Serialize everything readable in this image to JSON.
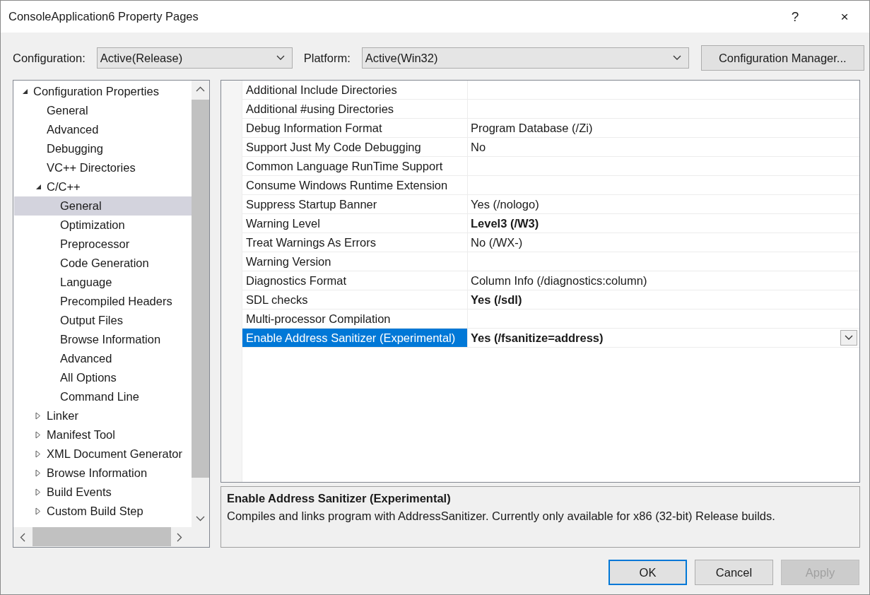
{
  "window": {
    "title": "ConsoleApplication6 Property Pages",
    "help": "?",
    "close": "×"
  },
  "configuration": {
    "label": "Configuration:",
    "value": "Active(Release)"
  },
  "platform": {
    "label": "Platform:",
    "value": "Active(Win32)"
  },
  "configuration_manager": "Configuration Manager...",
  "tree": {
    "items": [
      {
        "label": "Configuration Properties",
        "expanded": true,
        "selected": false,
        "children": [
          {
            "label": "General",
            "selected": false
          },
          {
            "label": "Advanced",
            "selected": false
          },
          {
            "label": "Debugging",
            "selected": false
          },
          {
            "label": "VC++ Directories",
            "selected": false
          },
          {
            "label": "C/C++",
            "expanded": true,
            "selected": false,
            "children": [
              {
                "label": "General",
                "selected": true
              },
              {
                "label": "Optimization",
                "selected": false
              },
              {
                "label": "Preprocessor",
                "selected": false
              },
              {
                "label": "Code Generation",
                "selected": false
              },
              {
                "label": "Language",
                "selected": false
              },
              {
                "label": "Precompiled Headers",
                "selected": false
              },
              {
                "label": "Output Files",
                "selected": false
              },
              {
                "label": "Browse Information",
                "selected": false
              },
              {
                "label": "Advanced",
                "selected": false
              },
              {
                "label": "All Options",
                "selected": false
              },
              {
                "label": "Command Line",
                "selected": false
              }
            ]
          },
          {
            "label": "Linker",
            "expanded": false,
            "selected": false
          },
          {
            "label": "Manifest Tool",
            "expanded": false,
            "selected": false
          },
          {
            "label": "XML Document Generator",
            "expanded": false,
            "selected": false
          },
          {
            "label": "Browse Information",
            "expanded": false,
            "selected": false
          },
          {
            "label": "Build Events",
            "expanded": false,
            "selected": false
          },
          {
            "label": "Custom Build Step",
            "expanded": false,
            "selected": false
          }
        ]
      }
    ]
  },
  "properties": [
    {
      "name": "Additional Include Directories",
      "selected": false
    },
    {
      "name": "Additional #using Directories",
      "selected": false
    },
    {
      "name": "Debug Information Format",
      "value": "Program Database (/Zi)",
      "bold": false,
      "selected": false
    },
    {
      "name": "Support Just My Code Debugging",
      "value": "No",
      "bold": false,
      "selected": false
    },
    {
      "name": "Common Language RunTime Support",
      "selected": false
    },
    {
      "name": "Consume Windows Runtime Extension",
      "selected": false
    },
    {
      "name": "Suppress Startup Banner",
      "value": "Yes (/nologo)",
      "bold": false,
      "selected": false
    },
    {
      "name": "Warning Level",
      "value": "Level3 (/W3)",
      "bold": true,
      "selected": false
    },
    {
      "name": "Treat Warnings As Errors",
      "value": "No (/WX-)",
      "bold": false,
      "selected": false
    },
    {
      "name": "Warning Version",
      "selected": false
    },
    {
      "name": "Diagnostics Format",
      "value": "Column Info (/diagnostics:column)",
      "bold": false,
      "selected": false
    },
    {
      "name": "SDL checks",
      "value": "Yes (/sdl)",
      "bold": true,
      "selected": false
    },
    {
      "name": "Multi-processor Compilation",
      "selected": false
    },
    {
      "name": "Enable Address Sanitizer (Experimental)",
      "value": "Yes (/fsanitize=address)",
      "bold": true,
      "selected": true
    }
  ],
  "description": {
    "title": "Enable Address Sanitizer (Experimental)",
    "text": "Compiles and links program with AddressSanitizer. Currently only available for x86 (32-bit) Release builds."
  },
  "buttons": [
    {
      "label": "OK",
      "default": true,
      "disabled": false
    },
    {
      "label": "Cancel",
      "default": false,
      "disabled": false
    },
    {
      "label": "Apply",
      "default": false,
      "disabled": true
    }
  ]
}
